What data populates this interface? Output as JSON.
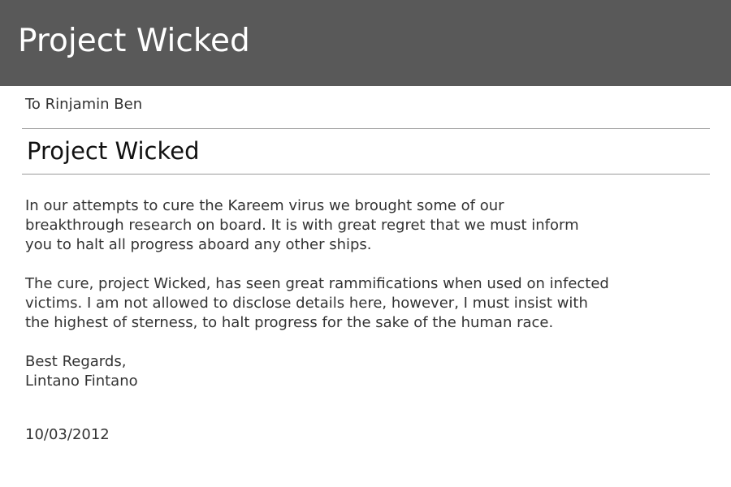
{
  "header": {
    "title": "Project Wicked"
  },
  "message": {
    "recipient": "To Rinjamin Ben",
    "subject": "Project Wicked",
    "paragraph_1": [
      "In our attempts to cure the Kareem virus we brought some of our",
      "breakthrough research on board. It is with great regret that we must inform",
      "you to halt all progress aboard any other ships."
    ],
    "paragraph_2": [
      "The cure, project Wicked, has seen great rammifications when used on infected",
      "victims. I am not allowed to disclose details here, however, I must insist with",
      "the highest of sterness, to halt progress for the sake of the human race."
    ],
    "closing": "Best Regards,",
    "signature": "Lintano Fintano",
    "date": "10/03/2012"
  },
  "colors": {
    "header_background": "#595959",
    "header_text": "#ffffff",
    "body_text": "#333333",
    "divider": "#9a9a9a",
    "page_background": "#ffffff"
  }
}
